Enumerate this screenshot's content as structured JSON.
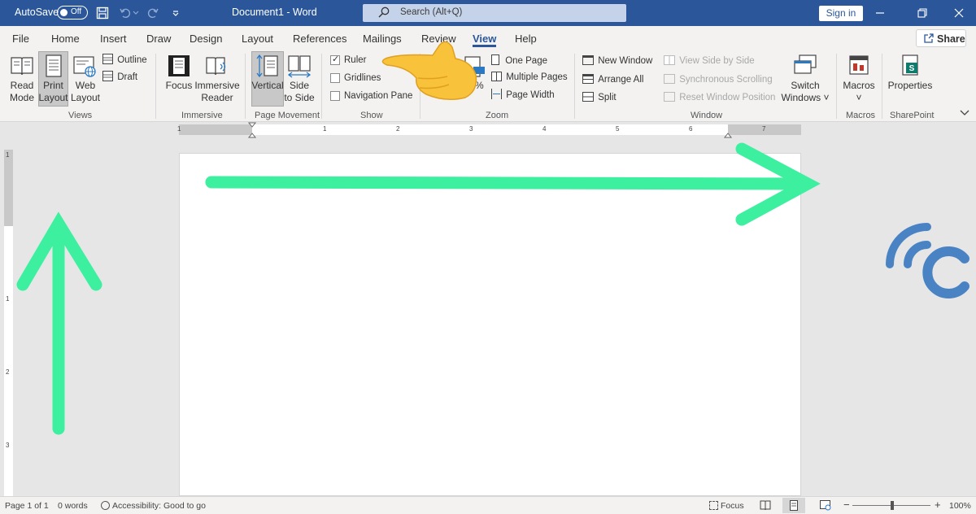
{
  "titlebar": {
    "autosave_label": "AutoSave",
    "autosave_state": "Off",
    "document_title": "Document1  -  Word",
    "search_placeholder": "Search (Alt+Q)",
    "signin_label": "Sign in",
    "bg_color": "#2b579a"
  },
  "tabs": [
    "File",
    "Home",
    "Insert",
    "Draw",
    "Design",
    "Layout",
    "References",
    "Mailings",
    "Review",
    "View",
    "Help"
  ],
  "active_tab": "View",
  "share_label": "Share",
  "ribbon": {
    "views": {
      "group_label": "Views",
      "read_mode": [
        "Read",
        "Mode"
      ],
      "print_layout": [
        "Print",
        "Layout"
      ],
      "web_layout": [
        "Web",
        "Layout"
      ],
      "outline": "Outline",
      "draft": "Draft"
    },
    "immersive": {
      "group_label": "Immersive",
      "focus": "Focus",
      "immersive_reader": [
        "Immersive",
        "Reader"
      ]
    },
    "page_movement": {
      "group_label": "Page Movement",
      "vertical": "Vertical",
      "side_to_side": [
        "Side",
        "to Side"
      ]
    },
    "show": {
      "group_label": "Show",
      "ruler": "Ruler",
      "gridlines": "Gridlines",
      "navigation_pane": "Navigation Pane"
    },
    "zoom": {
      "group_label": "Zoom",
      "hundred_partial": "0%",
      "one_page": "One Page",
      "multiple_pages": "Multiple Pages",
      "page_width": "Page Width"
    },
    "window": {
      "group_label": "Window",
      "new_window": "New Window",
      "arrange_all": "Arrange All",
      "split": "Split",
      "view_side_by_side": "View Side by Side",
      "synchronous_scrolling": "Synchronous Scrolling",
      "reset_window_position": "Reset Window Position",
      "switch_windows": [
        "Switch",
        "Windows ˅"
      ]
    },
    "macros": {
      "group_label": "Macros",
      "macros": "Macros",
      "macros_arrow": "˅"
    },
    "sharepoint": {
      "group_label": "SharePoint",
      "properties": "Properties"
    }
  },
  "ruler": {
    "h_numbers": [
      "1",
      "1",
      "2",
      "3",
      "4",
      "5",
      "6",
      "7"
    ],
    "v_numbers": [
      "1",
      "1",
      "2",
      "3"
    ]
  },
  "status": {
    "page": "Page 1 of 1",
    "words": "0 words",
    "accessibility": "Accessibility: Good to go",
    "focus": "Focus",
    "zoom_minus": "−",
    "zoom_plus": "+",
    "zoom_level": "100%"
  },
  "colors": {
    "accent": "#2b579a",
    "annotation_arrow": "#3cf0a0",
    "watermark": "#4a83c4"
  }
}
